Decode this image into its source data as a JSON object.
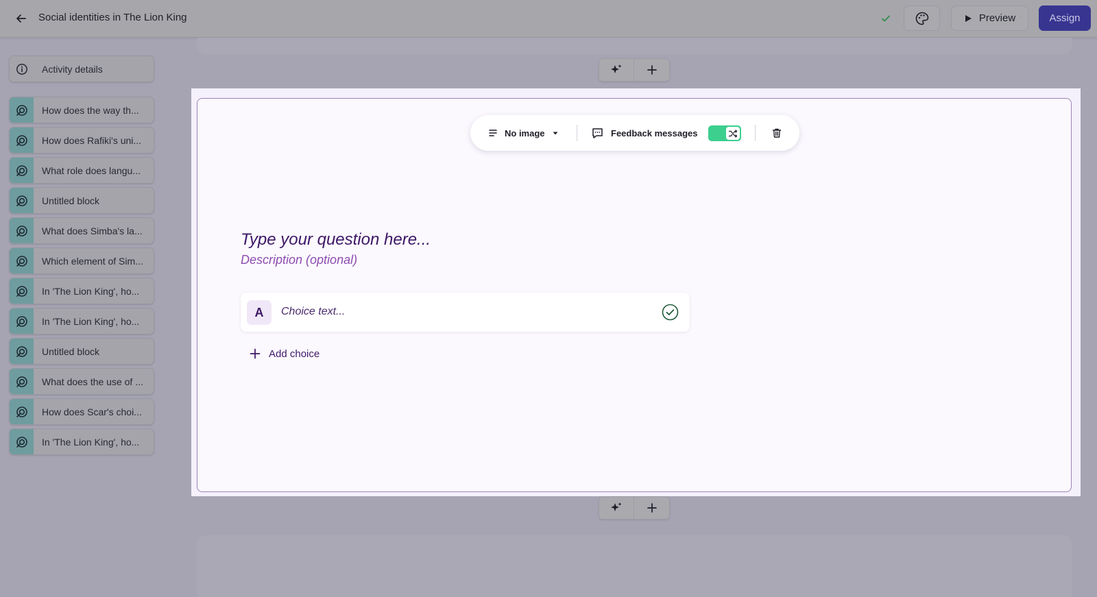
{
  "header": {
    "title": "Social identities in The Lion King",
    "preview_label": "Preview",
    "assign_label": "Assign"
  },
  "sidebar": {
    "details_label": "Activity details",
    "items": [
      {
        "label": "How does the way th..."
      },
      {
        "label": "How does Rafiki's uni..."
      },
      {
        "label": "What role does langu..."
      },
      {
        "label": "Untitled block"
      },
      {
        "label": "What does Simba's la..."
      },
      {
        "label": "Which element of Sim..."
      },
      {
        "label": "In 'The Lion King', ho..."
      },
      {
        "label": "In 'The Lion King', ho..."
      },
      {
        "label": "Untitled block"
      },
      {
        "label": "What does the use of ..."
      },
      {
        "label": "How does Scar's choi..."
      },
      {
        "label": "In 'The Lion King', ho..."
      }
    ]
  },
  "block": {
    "toolbar": {
      "image_label": "No image",
      "feedback_label": "Feedback messages",
      "shuffle_on": true
    },
    "question_placeholder": "Type your question here...",
    "description_placeholder": "Description (optional)",
    "choices": [
      {
        "letter": "A",
        "placeholder": "Choice text..."
      }
    ],
    "add_choice_label": "Add choice"
  },
  "colors": {
    "accent": "#383591",
    "toggle": "#3ccf8e",
    "question_text": "#3d1766",
    "description_text": "#8d4cb0",
    "sidebar_icon_bg": "#6f9c9f"
  }
}
